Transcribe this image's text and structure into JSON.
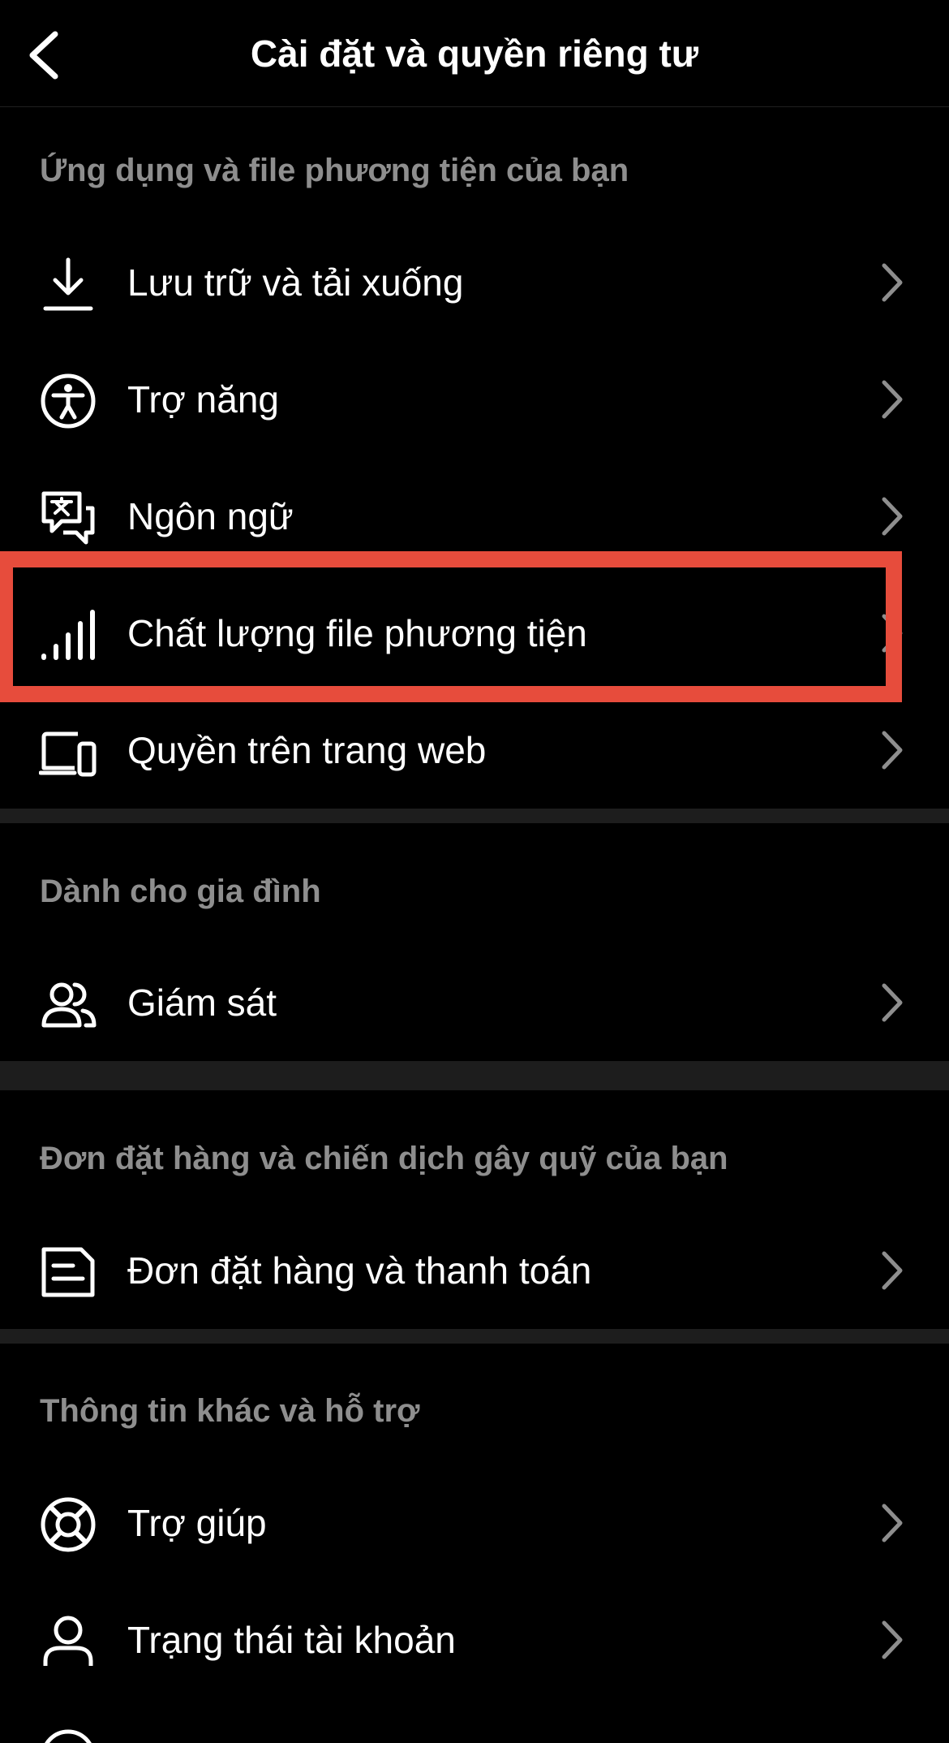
{
  "header": {
    "title": "Cài đặt và quyền riêng tư",
    "back_icon": "chevron-left-icon"
  },
  "sections": [
    {
      "title": "Ứng dụng và file phương tiện của bạn",
      "items": [
        {
          "label": "Lưu trữ và tải xuống",
          "icon": "download-icon"
        },
        {
          "label": "Trợ năng",
          "icon": "accessibility-icon"
        },
        {
          "label": "Ngôn ngữ",
          "icon": "translate-icon"
        },
        {
          "label": "Chất lượng file phương tiện",
          "icon": "signal-bars-icon"
        },
        {
          "label": "Quyền trên trang web",
          "icon": "devices-icon"
        }
      ]
    },
    {
      "title": "Dành cho gia đình",
      "items": [
        {
          "label": "Giám sát",
          "icon": "people-icon"
        }
      ]
    },
    {
      "title": "Đơn đặt hàng và chiến dịch gây quỹ của bạn",
      "items": [
        {
          "label": "Đơn đặt hàng và thanh toán",
          "icon": "receipt-icon"
        }
      ]
    },
    {
      "title": "Thông tin khác và hỗ trợ",
      "items": [
        {
          "label": "Trợ giúp",
          "icon": "lifebuoy-icon"
        },
        {
          "label": "Trạng thái tài khoản",
          "icon": "person-icon"
        }
      ]
    }
  ],
  "highlight_color": "#e74c3c",
  "background_color": "#000000",
  "section_title_color": "#8e8e8e"
}
